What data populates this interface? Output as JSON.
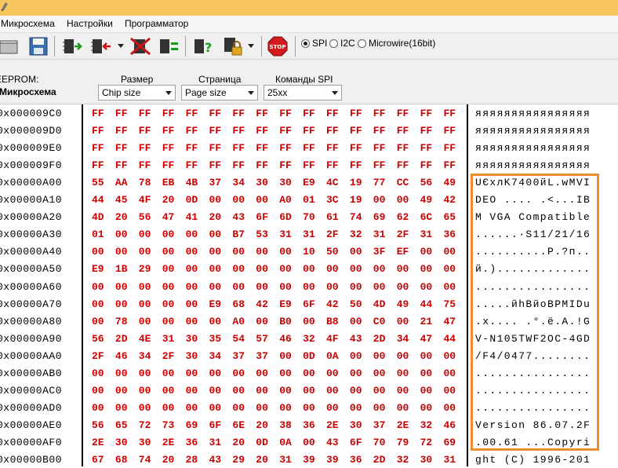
{
  "menu": [
    "Микросхема",
    "Настройки",
    "Программатор"
  ],
  "toolbar": {
    "icons": [
      "open-icon",
      "save-icon",
      "read-chip-icon",
      "write-chip-icon",
      "erase-chip-icon",
      "verify-chip-icon",
      "blank-check-icon",
      "protect-icon",
      "stop-icon"
    ],
    "stop_label": "STOP",
    "radios": [
      {
        "label": "SPI",
        "checked": true
      },
      {
        "label": "I2C",
        "checked": false
      },
      {
        "label": "Microwire(16bit)",
        "checked": false
      }
    ]
  },
  "options": {
    "eeprom_label": "EEPROM:",
    "chip_label": "Микросхема",
    "size_label": "Размер",
    "size_value": "Chip size",
    "page_label": "Страница",
    "page_value": "Page size",
    "commands_label": "Команды SPI",
    "commands_value": "25xx"
  },
  "hex_rows": [
    {
      "addr": "0x000009C0",
      "bytes": [
        "FF",
        "FF",
        "FF",
        "FF",
        "FF",
        "FF",
        "FF",
        "FF",
        "FF",
        "FF",
        "FF",
        "FF",
        "FF",
        "FF",
        "FF",
        "FF"
      ],
      "ascii": "яяяяяяяяяяяяяяяя"
    },
    {
      "addr": "0x000009D0",
      "bytes": [
        "FF",
        "FF",
        "FF",
        "FF",
        "FF",
        "FF",
        "FF",
        "FF",
        "FF",
        "FF",
        "FF",
        "FF",
        "FF",
        "FF",
        "FF",
        "FF"
      ],
      "ascii": "яяяяяяяяяяяяяяяя"
    },
    {
      "addr": "0x000009E0",
      "bytes": [
        "FF",
        "FF",
        "FF",
        "FF",
        "FF",
        "FF",
        "FF",
        "FF",
        "FF",
        "FF",
        "FF",
        "FF",
        "FF",
        "FF",
        "FF",
        "FF"
      ],
      "ascii": "яяяяяяяяяяяяяяяя"
    },
    {
      "addr": "0x000009F0",
      "bytes": [
        "FF",
        "FF",
        "FF",
        "FF",
        "FF",
        "FF",
        "FF",
        "FF",
        "FF",
        "FF",
        "FF",
        "FF",
        "FF",
        "FF",
        "FF",
        "FF"
      ],
      "ascii": "яяяяяяяяяяяяяяяя"
    },
    {
      "addr": "0x00000A00",
      "bytes": [
        "55",
        "AA",
        "78",
        "EB",
        "4B",
        "37",
        "34",
        "30",
        "30",
        "E9",
        "4C",
        "19",
        "77",
        "CC",
        "56",
        "49"
      ],
      "ascii": "UЄxлK7400йL.wMVI"
    },
    {
      "addr": "0x00000A10",
      "bytes": [
        "44",
        "45",
        "4F",
        "20",
        "0D",
        "00",
        "00",
        "00",
        "A0",
        "01",
        "3C",
        "19",
        "00",
        "00",
        "49",
        "42"
      ],
      "ascii": "DEO .... .<...IB"
    },
    {
      "addr": "0x00000A20",
      "bytes": [
        "4D",
        "20",
        "56",
        "47",
        "41",
        "20",
        "43",
        "6F",
        "6D",
        "70",
        "61",
        "74",
        "69",
        "62",
        "6C",
        "65"
      ],
      "ascii": "M VGA Compatible"
    },
    {
      "addr": "0x00000A30",
      "bytes": [
        "01",
        "00",
        "00",
        "00",
        "00",
        "00",
        "B7",
        "53",
        "31",
        "31",
        "2F",
        "32",
        "31",
        "2F",
        "31",
        "36"
      ],
      "ascii": "......·S11/21/16"
    },
    {
      "addr": "0x00000A40",
      "bytes": [
        "00",
        "00",
        "00",
        "00",
        "00",
        "00",
        "00",
        "00",
        "00",
        "10",
        "50",
        "00",
        "3F",
        "EF",
        "00",
        "00"
      ],
      "ascii": "..........P.?п.."
    },
    {
      "addr": "0x00000A50",
      "bytes": [
        "E9",
        "1B",
        "29",
        "00",
        "00",
        "00",
        "00",
        "00",
        "00",
        "00",
        "00",
        "00",
        "00",
        "00",
        "00",
        "00"
      ],
      "ascii": "й.)............."
    },
    {
      "addr": "0x00000A60",
      "bytes": [
        "00",
        "00",
        "00",
        "00",
        "00",
        "00",
        "00",
        "00",
        "00",
        "00",
        "00",
        "00",
        "00",
        "00",
        "00",
        "00"
      ],
      "ascii": "................"
    },
    {
      "addr": "0x00000A70",
      "bytes": [
        "00",
        "00",
        "00",
        "00",
        "00",
        "E9",
        "68",
        "42",
        "E9",
        "6F",
        "42",
        "50",
        "4D",
        "49",
        "44",
        "75"
      ],
      "ascii": ".....йhBйoBPMIDu"
    },
    {
      "addr": "0x00000A80",
      "bytes": [
        "00",
        "78",
        "00",
        "00",
        "00",
        "00",
        "A0",
        "00",
        "B0",
        "00",
        "B8",
        "00",
        "C0",
        "00",
        "21",
        "47"
      ],
      "ascii": ".x.... .°.ё.A.!G"
    },
    {
      "addr": "0x00000A90",
      "bytes": [
        "56",
        "2D",
        "4E",
        "31",
        "30",
        "35",
        "54",
        "57",
        "46",
        "32",
        "4F",
        "43",
        "2D",
        "34",
        "47",
        "44"
      ],
      "ascii": "V-N105TWF2OC-4GD"
    },
    {
      "addr": "0x00000AA0",
      "bytes": [
        "2F",
        "46",
        "34",
        "2F",
        "30",
        "34",
        "37",
        "37",
        "00",
        "0D",
        "0A",
        "00",
        "00",
        "00",
        "00",
        "00"
      ],
      "ascii": "/F4/0477........"
    },
    {
      "addr": "0x00000AB0",
      "bytes": [
        "00",
        "00",
        "00",
        "00",
        "00",
        "00",
        "00",
        "00",
        "00",
        "00",
        "00",
        "00",
        "00",
        "00",
        "00",
        "00"
      ],
      "ascii": "................"
    },
    {
      "addr": "0x00000AC0",
      "bytes": [
        "00",
        "00",
        "00",
        "00",
        "00",
        "00",
        "00",
        "00",
        "00",
        "00",
        "00",
        "00",
        "00",
        "00",
        "00",
        "00"
      ],
      "ascii": "................"
    },
    {
      "addr": "0x00000AD0",
      "bytes": [
        "00",
        "00",
        "00",
        "00",
        "00",
        "00",
        "00",
        "00",
        "00",
        "00",
        "00",
        "00",
        "00",
        "00",
        "00",
        "00"
      ],
      "ascii": "................"
    },
    {
      "addr": "0x00000AE0",
      "bytes": [
        "56",
        "65",
        "72",
        "73",
        "69",
        "6F",
        "6E",
        "20",
        "38",
        "36",
        "2E",
        "30",
        "37",
        "2E",
        "32",
        "46"
      ],
      "ascii": "Version 86.07.2F"
    },
    {
      "addr": "0x00000AF0",
      "bytes": [
        "2E",
        "30",
        "30",
        "2E",
        "36",
        "31",
        "20",
        "0D",
        "0A",
        "00",
        "43",
        "6F",
        "70",
        "79",
        "72",
        "69"
      ],
      "ascii": ".00.61 ...Copyri"
    },
    {
      "addr": "0x00000B00",
      "bytes": [
        "67",
        "68",
        "74",
        "20",
        "28",
        "43",
        "29",
        "20",
        "31",
        "39",
        "39",
        "36",
        "2D",
        "32",
        "30",
        "31"
      ],
      "ascii": "ght (C) 1996-201"
    }
  ],
  "colors": {
    "byte": "#cc0000",
    "highlight": "#f08c2e",
    "titlebar": "#f6c65c"
  }
}
